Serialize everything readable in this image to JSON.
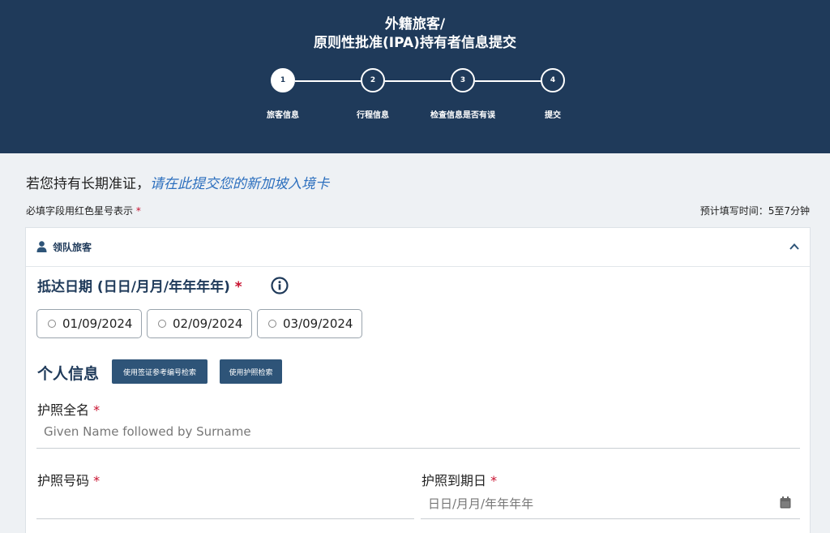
{
  "header": {
    "title_line1": "外籍旅客/",
    "title_line2": "原则性批准(IPA)持有者信息提交",
    "steps": [
      {
        "number": "1",
        "label": "旅客信息"
      },
      {
        "number": "2",
        "label": "行程信息"
      },
      {
        "number": "3",
        "label": "检查信息是否有误"
      },
      {
        "number": "4",
        "label": "提交"
      }
    ],
    "active_step": 1
  },
  "intro": {
    "long_term_text": "若您持有长期准证，",
    "long_term_link": "请在此提交您的新加坡入境卡",
    "required_note": "必填字段用红色星号表示",
    "eta_note": "预计填写时间：5至7分钟"
  },
  "card": {
    "title": "领队旅客",
    "arrival": {
      "title": "抵达日期 (日日/月月/年年年年)",
      "options": [
        "01/09/2024",
        "02/09/2024",
        "03/09/2024"
      ]
    },
    "personal": {
      "title": "个人信息",
      "visa_search_button": "使用签证参考编号检索",
      "passport_search_button": "使用护照检索"
    },
    "fields": {
      "full_name_label": "护照全名",
      "full_name_placeholder": "Given Name followed by Surname",
      "passport_no_label": "护照号码",
      "passport_no_value": "",
      "expiry_label": "护照到期日",
      "expiry_placeholder": "日日/月月/年年年年"
    }
  },
  "required_star": "*",
  "colors": {
    "header_bg": "#1f3a5a",
    "accent": "#2e5478",
    "link": "#2c6fbe",
    "required": "#c8102e"
  }
}
